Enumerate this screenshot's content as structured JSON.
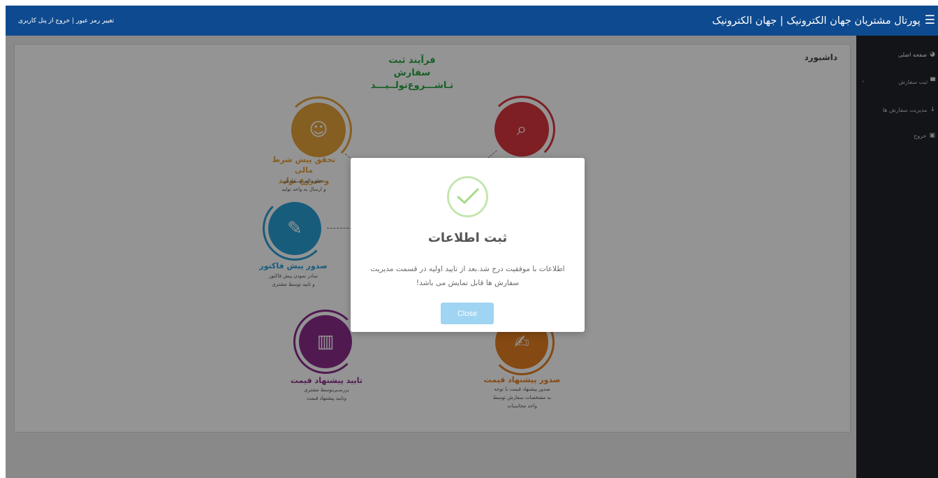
{
  "header": {
    "title": "پورتال مشتریان جهان الکترونیک | جهان الکترونیک",
    "menu_icon": "hamburger-icon",
    "change_password": "تغییر رمز عبور",
    "separator": "|",
    "logout_panel": "خروج از پنل کاربری"
  },
  "sidebar": {
    "items": [
      {
        "label": "صفحه اصلی",
        "icon": "dashboard-icon"
      },
      {
        "label": "ثبت سفارش",
        "icon": "cart-icon"
      },
      {
        "label": "مدیریت سفارش ها",
        "icon": "download-icon"
      },
      {
        "label": "خروج",
        "icon": "exit-icon"
      }
    ]
  },
  "main": {
    "title": "داشبورد",
    "infographic": {
      "heading_line1": "فرآیند ثبت سفارش",
      "heading_line2": "تـاشـــروع‌تولــیـــد",
      "steps": [
        {
          "title_line1": "تحقق پیش شرط مالی",
          "title_line2": "و شروع تولید",
          "desc_line1": "تحقق‌مالـی‌ســفارش",
          "desc_line2": "و ارسال به واحد تولید",
          "color": "#e6a23c"
        },
        {
          "title_line1": "صدور پیش فاکتور",
          "title_line2": "",
          "desc_line1": "سادر نمودن پیش فاکتور",
          "desc_line2": "و تایید توسط مشتری",
          "color": "#2a9fd6"
        },
        {
          "title_line1": "تایید پیشنهاد قیمت",
          "title_line2": "",
          "desc_line1": "بررسـی‌توسط مشتری",
          "desc_line2": "وتایید پیشنهاد قیمت",
          "color": "#8b2d8c"
        },
        {
          "title_line1": "صدور پیشنهاد قیمت",
          "title_line2": "",
          "desc_line1": "صدور پیشنهاد قیمت با توجه",
          "desc_line2": "به مشخصات سفارش توسط",
          "desc_line3": "واحد محاسبات",
          "color": "#e67e22"
        },
        {
          "title_line1": "",
          "title_line2": "",
          "desc_line1": "",
          "desc_line2": "",
          "color": "#d9363e"
        }
      ]
    }
  },
  "modal": {
    "title": "ثبت اطلاعات",
    "message": "اطلاعات با موفقیت درج شد.بعد از تایید اولیه در قسمت مدیریت سفارش ها قابل نمایش می باشد!",
    "close_label": "Close",
    "success_color": "#a5dc86",
    "button_color": "#9fd4f2"
  }
}
